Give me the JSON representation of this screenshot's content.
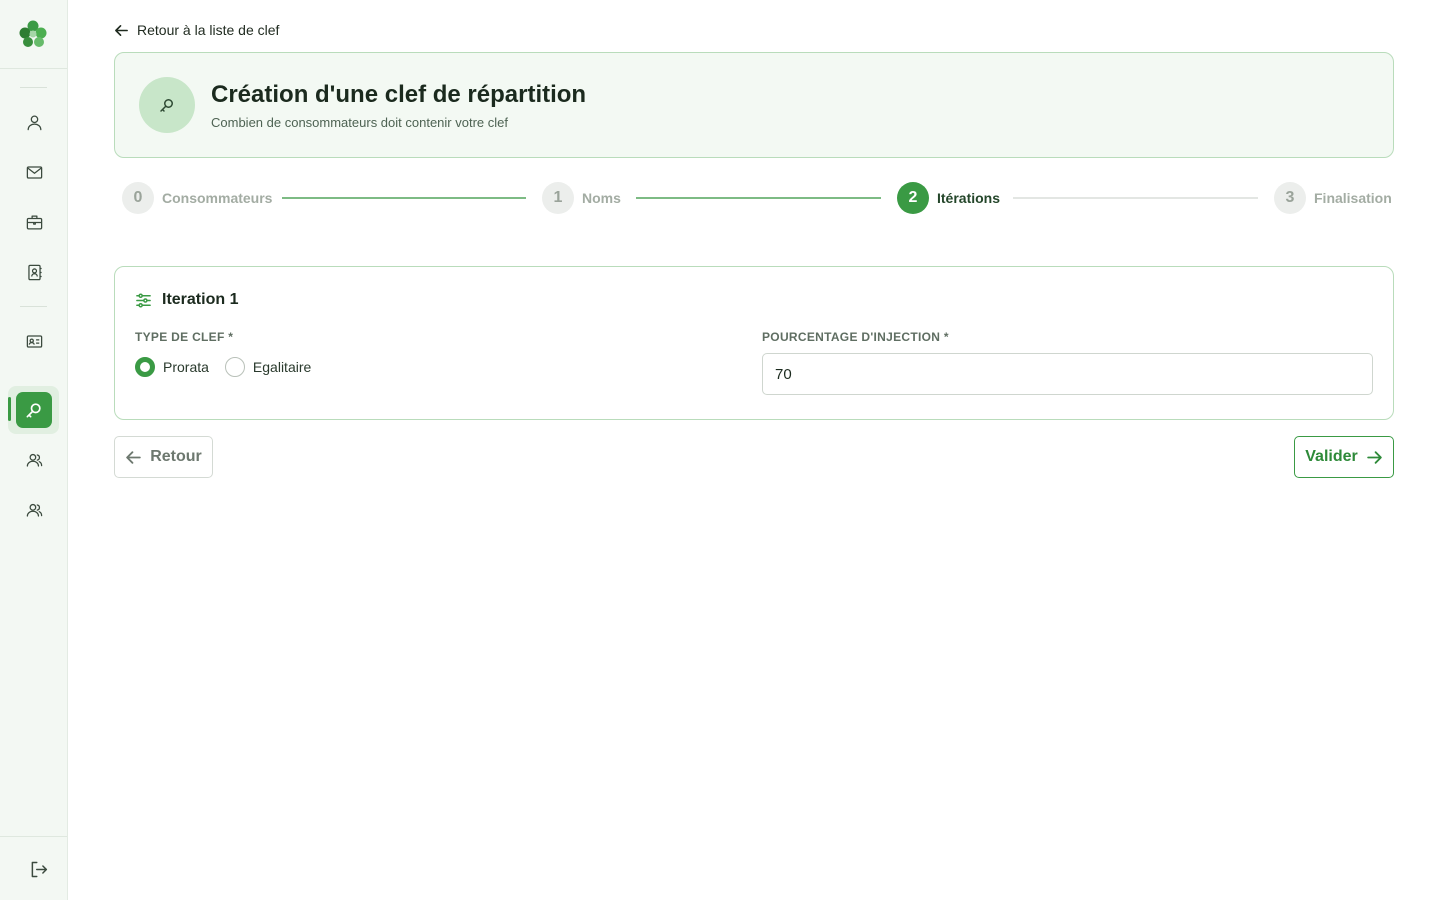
{
  "back_link": {
    "label": "Retour à la liste de clef"
  },
  "header": {
    "title": "Création d'une clef de répartition",
    "subtitle": "Combien de consommateurs doit contenir votre clef"
  },
  "stepper": {
    "steps": [
      {
        "number": "0",
        "label": "Consommateurs",
        "state": "done"
      },
      {
        "number": "1",
        "label": "Noms",
        "state": "done"
      },
      {
        "number": "2",
        "label": "Itérations",
        "state": "current"
      },
      {
        "number": "3",
        "label": "Finalisation",
        "state": "todo"
      }
    ]
  },
  "iteration": {
    "title": "Iteration 1",
    "key_type": {
      "label": "TYPE DE CLEF *",
      "options": [
        {
          "label": "Prorata",
          "selected": true
        },
        {
          "label": "Egalitaire",
          "selected": false
        }
      ]
    },
    "injection": {
      "label": "POURCENTAGE D'INJECTION *",
      "value": "70"
    }
  },
  "actions": {
    "back_label": "Retour",
    "submit_label": "Valider"
  },
  "sidebar": {
    "items": [
      {
        "icon": "user-icon"
      },
      {
        "icon": "mail-icon"
      },
      {
        "icon": "briefcase-icon"
      },
      {
        "icon": "contact-book-icon"
      },
      {
        "icon": "id-card-icon"
      },
      {
        "icon": "key-search-icon",
        "active": true
      },
      {
        "icon": "users-icon"
      },
      {
        "icon": "users-icon"
      }
    ],
    "logout_icon": "logout-icon"
  },
  "colors": {
    "accent": "#3a9a44",
    "accent_light": "#c8e6c9",
    "card_border": "#b9dcbb",
    "header_bg": "#f3f9f3",
    "sidebar_bg": "#f3f8f3"
  }
}
